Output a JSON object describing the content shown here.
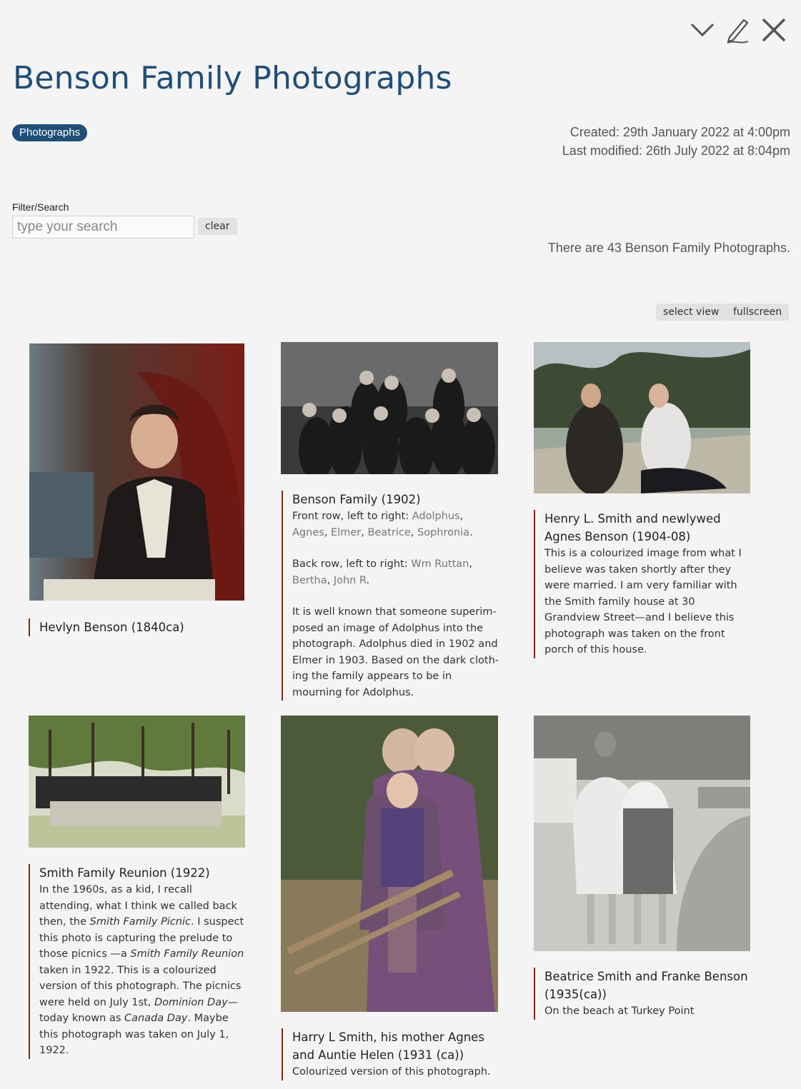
{
  "header": {
    "title": "Benson Family Photographs",
    "tag": "Photographs",
    "created": "Created: 29th January 2022 at 4:00pm",
    "modified": "Last modified: 26th July 2022 at 8:04pm"
  },
  "toolbar": {
    "icons": [
      "chevron-down-icon",
      "pencil-icon",
      "close-icon"
    ]
  },
  "filter": {
    "label": "Filter/Search",
    "placeholder": "type your search",
    "clear_label": "clear"
  },
  "count_text": "There are 43 Benson Family Photographs.",
  "view": {
    "select_view_label": "select view",
    "fullscreen_label": "fullscreen"
  },
  "colors": {
    "accent": "#1f4e79",
    "caption_border": "#7a2a1a",
    "name_link": "#777777",
    "background": "#f4f4f4"
  },
  "photos": [
    {
      "title": "Hevlyn Benson (1840ca)"
    },
    {
      "title": "Benson Family (1902)",
      "front_prefix": "Front row, left to right: ",
      "front_names": [
        "Adolphus",
        "Agnes",
        "Elmer",
        "Beatrice",
        "Sophronia"
      ],
      "back_prefix": "Back row, left to right: ",
      "back_names": [
        "Wm Ruttan",
        "Bertha",
        "John R"
      ],
      "note": "It is well known that someone superim­posed an image of Adolphus into the photograph. Adolphus died in 1902 and Elmer in 1903. Based on the dark cloth­ing the family appears to be in mourning for Adolphus."
    },
    {
      "title": "Henry L. Smith and newlywed Agnes Benson (1904-08)",
      "desc": "This is a colourized image from what I believe was taken shortly after they were married. I am very familiar with the Smith family house at 30 Grandview Street—and I believe this photograph was taken on the front porch of this house."
    },
    {
      "title": "Smith Family Reunion (1922)",
      "desc_1": "In the 1960s, as a kid, I recall attending, what I think we called back then, the ",
      "desc_2": "Smith Family Picnic",
      "desc_3": ". I suspect this photo is capturing the prelude to those picnics —a ",
      "desc_4": "Smith Family Reunion",
      "desc_5": " taken in 1922. This is a colourized version of this photo­graph. The picnics were held on July 1st, ",
      "desc_6": "Dominion Day",
      "desc_7": "—today known as ",
      "desc_8": "Canada Day",
      "desc_9": ". Maybe this photograph was taken on July 1, 1922."
    },
    {
      "title": "Harry L Smith, his mother Agnes and Auntie Helen (1931 (ca))",
      "desc": "Colourized version of this photograph."
    },
    {
      "title": "Beatrice Smith and Franke Benson (1935(ca))",
      "desc": "On the beach at Turkey Point"
    }
  ]
}
